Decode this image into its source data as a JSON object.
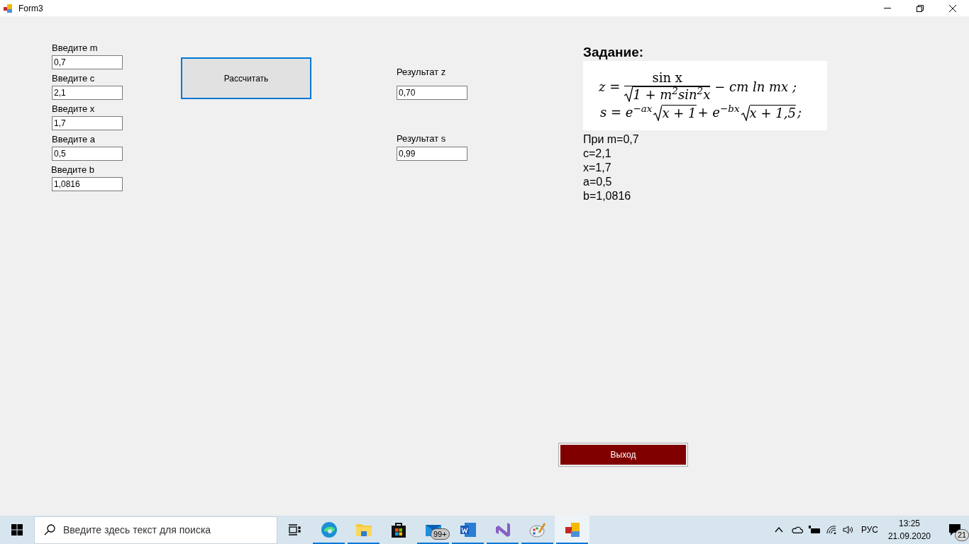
{
  "window": {
    "title": "Form3"
  },
  "inputs": [
    {
      "label": "Введите m",
      "value": "0,7"
    },
    {
      "label": "Введите c",
      "value": "2,1"
    },
    {
      "label": "Введите x",
      "value": "1,7"
    },
    {
      "label": "Введите a",
      "value": "0,5"
    },
    {
      "label": "Введите b",
      "value": "1,0816"
    }
  ],
  "calculate_button": "Рассчитать",
  "results": [
    {
      "label": "Результат z",
      "value": "0,70"
    },
    {
      "label": "Результат s",
      "value": "0,99"
    }
  ],
  "task": {
    "heading": "Задание:",
    "formula_z": {
      "lhs": "z =",
      "numerator": "sin x",
      "denominator": "1 + m$^{2}$sin$^{2}$x",
      "tail": "− cm ln mx ;"
    },
    "formula_s": [
      {
        "kind": "text",
        "text": "s = e$^{−ax}$"
      },
      {
        "kind": "sqrt",
        "text": "x + 1"
      },
      {
        "kind": "text",
        "text": "+ e$^{−bx}$"
      },
      {
        "kind": "sqrt",
        "text": "x + 1,5"
      },
      {
        "kind": "text",
        "text": ";"
      }
    ],
    "values": [
      "При m=0,7",
      "c=2,1",
      "x=1,7",
      "a=0,5",
      "b=1,0816"
    ]
  },
  "exit_button": "Выход",
  "taskbar": {
    "search_placeholder": "Введите здесь текст для поиска",
    "apps": [
      {
        "kind": "edge",
        "running": true,
        "selected": false
      },
      {
        "kind": "folder",
        "running": true,
        "selected": false
      },
      {
        "kind": "store",
        "running": false,
        "selected": false
      },
      {
        "kind": "mail",
        "running": true,
        "selected": false,
        "badge": "99+"
      },
      {
        "kind": "word",
        "running": true,
        "selected": false
      },
      {
        "kind": "vs",
        "running": true,
        "selected": false
      },
      {
        "kind": "paint",
        "running": true,
        "selected": false
      },
      {
        "kind": "form",
        "running": true,
        "selected": true
      }
    ],
    "language": "РУС",
    "time": "13:25",
    "date": "21.09.2020",
    "notifications": "21"
  }
}
